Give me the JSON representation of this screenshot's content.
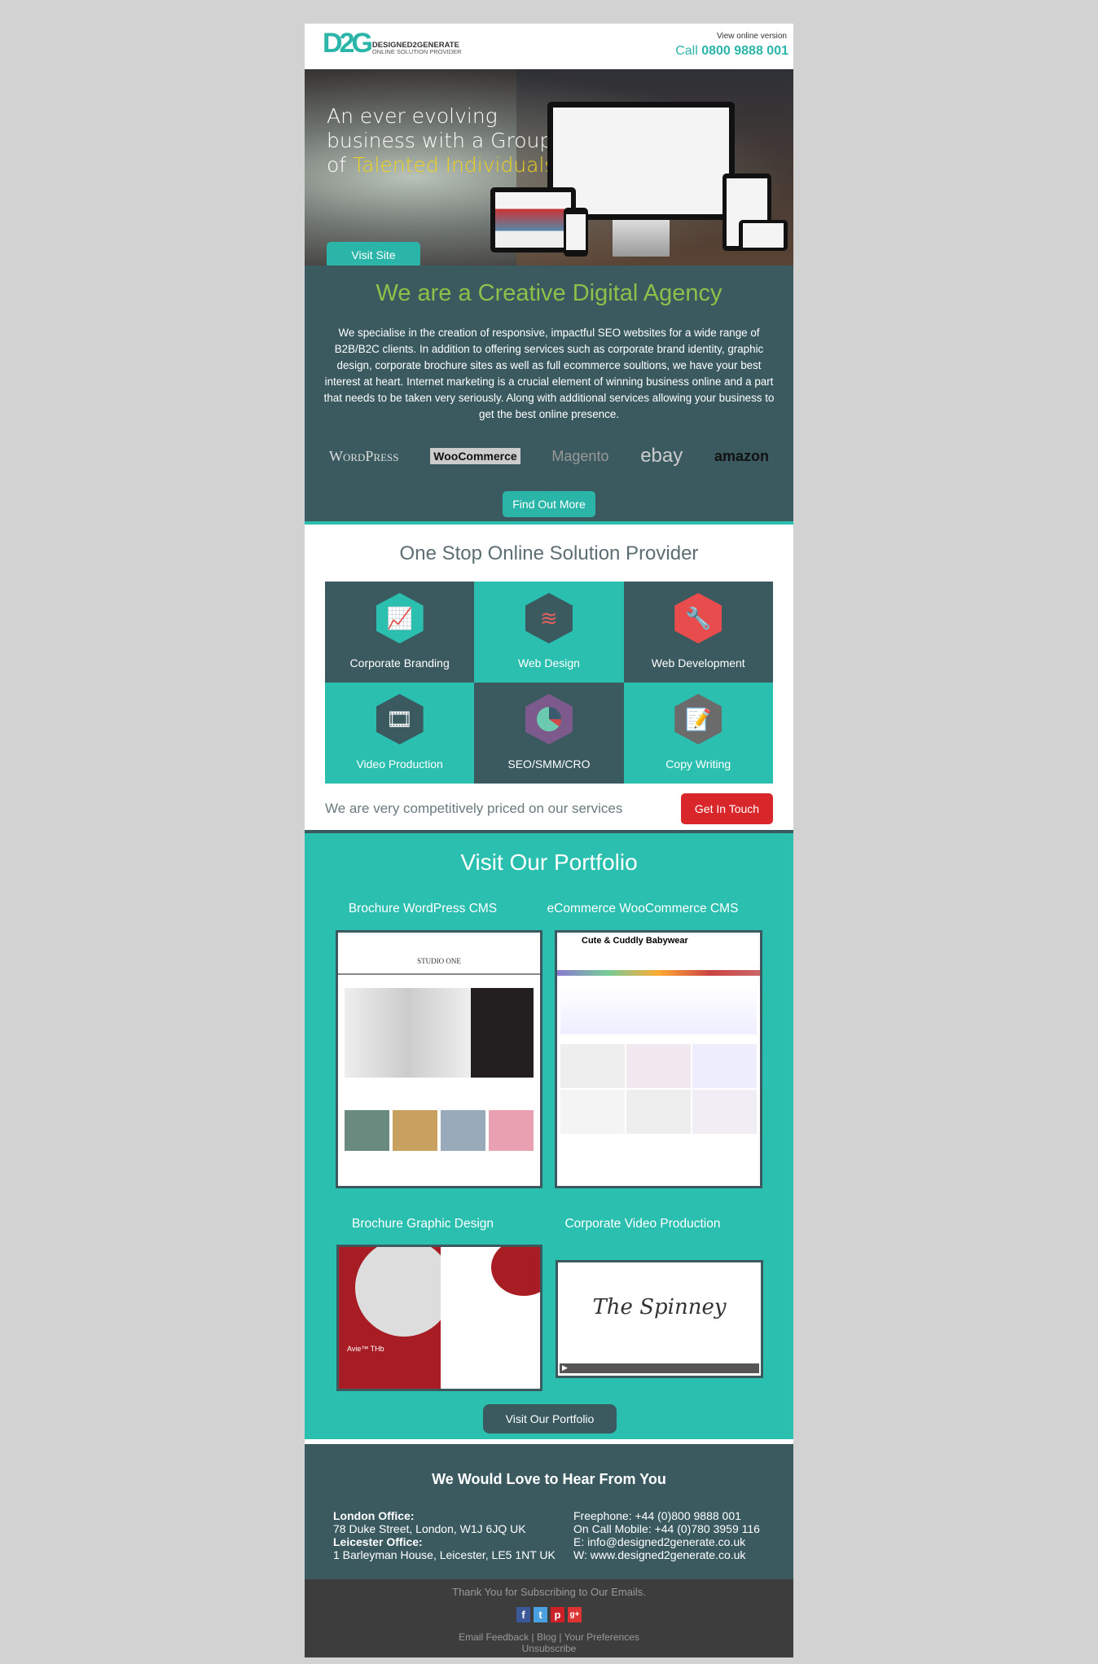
{
  "header": {
    "logo_mark": "D2G",
    "logo_name": "DESIGNED2GENERATE",
    "logo_tagline": "ONLINE SOLUTION PROVIDER",
    "view_online": "View online version",
    "call_label": "Call",
    "call_number": "0800 9888 001"
  },
  "hero": {
    "line1": "An ever evolving",
    "line2": "business with a Group",
    "line3_prefix": "of ",
    "line3_highlight": "Talented Individuals",
    "button": "Visit Site"
  },
  "agency": {
    "title": "We are a Creative Digital Agency",
    "body": "We specialise in the creation of responsive, impactful SEO websites for a wide range of B2B/B2C clients. In addition to offering services such as corporate brand identity, graphic design, corporate brochure sites as well as full ecommerce soultions, we have your best interest at heart. Internet marketing is a crucial element of winning business online and a part that needs to be taken very seriously. Along with additional services allowing your business to get the best online presence.",
    "brands": [
      "WordPress",
      "WooCommerce",
      "Magento",
      "ebay",
      "amazon"
    ],
    "button": "Find Out More"
  },
  "services": {
    "title": "One Stop Online Solution Provider",
    "items": [
      {
        "label": "Corporate Branding",
        "icon": "easel-icon",
        "color": "#2bbfb0"
      },
      {
        "label": "Web Design",
        "icon": "layers-icon",
        "color": "#3a5a60"
      },
      {
        "label": "Web Development",
        "icon": "tools-icon",
        "color": "#e84c4c"
      },
      {
        "label": "Video Production",
        "icon": "film-icon",
        "color": "#3a5a60"
      },
      {
        "label": "SEO/SMM/CRO",
        "icon": "pie-chart-icon",
        "color": "#7c5a8c"
      },
      {
        "label": "Copy Writing",
        "icon": "pencil-note-icon",
        "color": "#6b6b6b"
      }
    ],
    "price_text": "We are very competitively priced on our services",
    "button": "Get In Touch"
  },
  "portfolio": {
    "title": "Visit Our Portfolio",
    "items": [
      {
        "label": "Brochure WordPress CMS",
        "site": "STUDIO ONE"
      },
      {
        "label": "eCommerce WooCommerce CMS",
        "site": "Cute & Cuddly Babywear"
      },
      {
        "label": "Brochure Graphic Design",
        "site": "Avie™ THb"
      },
      {
        "label": "Corporate Video Production",
        "site": "The Spinney"
      }
    ],
    "button": "Visit Our Portfolio"
  },
  "contact": {
    "title": "We Would Love to Hear From You",
    "london_label": "London Office:",
    "london_addr": "78 Duke Street, London, W1J 6JQ UK",
    "leicester_label": "Leicester Office:",
    "leicester_addr": "1 Barleyman House, Leicester, LE5 1NT UK",
    "freephone": "Freephone: +44 (0)800 9888 001",
    "mobile": "On Call Mobile: +44 (0)780 3959 116",
    "email": "E: info@designed2generate.co.uk",
    "web": "W: www.designed2generate.co.uk"
  },
  "footer": {
    "thanks": "Thank You for Subscribing to Our Emails.",
    "social": [
      "f",
      "t",
      "p",
      "g+"
    ],
    "feedback": "Email Feedback",
    "blog": "Blog",
    "prefs": "Your Preferences",
    "sep": "|",
    "unsubscribe": "Unsubscribe"
  },
  "colors": {
    "teal": "#2bbfb0",
    "dark_teal": "#3a5a60",
    "green": "#8dc04a",
    "red": "#d9262b"
  }
}
